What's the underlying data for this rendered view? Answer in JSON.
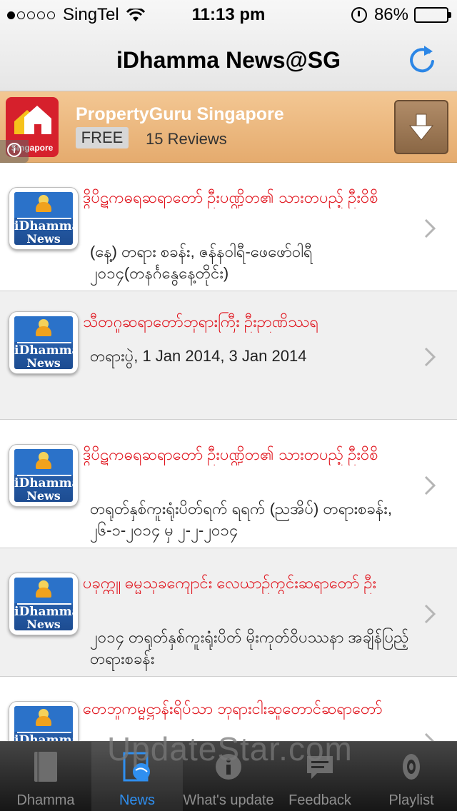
{
  "status_bar": {
    "carrier": "SingTel",
    "time": "11:13 pm",
    "battery_percent": "86%",
    "battery_level": 0.86,
    "signal_filled": 1,
    "signal_total": 5
  },
  "nav": {
    "title": "iDhamma News@SG",
    "refresh_icon": "refresh-icon"
  },
  "ad": {
    "title": "PropertyGuru Singapore",
    "logo_caption": "Singapore",
    "price": "FREE",
    "reviews": "15 Reviews",
    "download_icon": "download-arrow-icon",
    "info_icon": "info-icon"
  },
  "thumb": {
    "name1": "iDhamma",
    "name2": "News"
  },
  "news": [
    {
      "title": "ဒွိပိဋကဓရဆရာတော် ဦးပဏ္ဍိတ၏ သားတပည့် ဦးဝိစိ",
      "subtitle": "(နေ့) တရား စခန်း, ဇန်နဝါရီ-ဖေဖော်ဝါရီ ၂၀၁၄(တနင်္ဂနွေနေ့တိုင်း)"
    },
    {
      "title": "သီတဂူဆရာတော်ဘုရားကြီး ဦးဉာဏိဿရ",
      "subtitle": "တရားပွဲ, 1 Jan 2014, 3 Jan 2014"
    },
    {
      "title": "ဒွိပိဋကဓရဆရာတော် ဦးပဏ္ဍိတ၏ သားတပည့် ဦးဝိစိ",
      "subtitle": "တရုတ်နှစ်ကူးရုံးပိတ်ရက် ရရက် (ညအိပ်) တရားစခန်း, ၂၆-၁-၂၀၁၄ မှ ၂-၂-၂၀၁၄"
    },
    {
      "title": "ပခုက္ကူ ဓမ္မသုခကျောင်း လေယာဉ်ကွင်းဆရာတော် ဦး",
      "subtitle": "၂၀၁၄ တရုတ်နှစ်ကူးရုံးပိတ် မိုးကုတ်ဝိပဿနာ အချိန်ပြည့် တရားစခန်း"
    },
    {
      "title": "တေဘူကမ္မဋ္ဌာန်းရိပ်သာ ဘုရားငါးဆူတောင်ဆရာတော်",
      "subtitle": ""
    }
  ],
  "tabs": [
    {
      "label": "Dhamma",
      "icon": "book-icon",
      "active": false
    },
    {
      "label": "News",
      "icon": "globe-news-icon",
      "active": true
    },
    {
      "label": "What's update",
      "icon": "info-circle-icon",
      "active": false
    },
    {
      "label": "Feedback",
      "icon": "speech-bubble-icon",
      "active": false
    },
    {
      "label": "Playlist",
      "icon": "speaker-icon",
      "active": false
    }
  ],
  "watermark": "UpdateStar.com"
}
